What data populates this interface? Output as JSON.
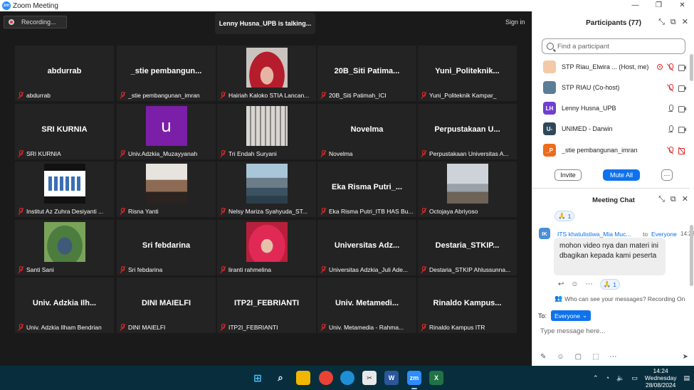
{
  "window": {
    "title": "Zoom Meeting",
    "controls": [
      "—",
      "❐",
      "✕"
    ]
  },
  "meeting": {
    "recording_label": "Recording...",
    "talking_label": "Lenny Husna_UPB is talking...",
    "signin_label": "Sign in",
    "tiles": [
      {
        "center": "abdurrab",
        "name": "abdurrab",
        "thumb": ""
      },
      {
        "center": "_stie pembangun...",
        "name": "_stie pembangunan_imran",
        "thumb": ""
      },
      {
        "center": "",
        "name": "Hairiah Kaloko STIA Lancan...",
        "thumb": "hijab-red"
      },
      {
        "center": "20B_Siti Patima...",
        "name": "20B_Siti Patimah_ICI",
        "thumb": ""
      },
      {
        "center": "Yuni_Politeknik...",
        "name": "Yuni_Politeknik Kampar_",
        "thumb": ""
      },
      {
        "center": "SRI KURNIA",
        "name": "SRI KURNIA",
        "thumb": ""
      },
      {
        "center": "",
        "name": "Univ.Adzkia_Muzayyanah",
        "thumb": "letter-u",
        "letter": "u"
      },
      {
        "center": "",
        "name": "Tri Endah Suryani",
        "thumb": "forest"
      },
      {
        "center": "Novelma",
        "name": "Novelma",
        "thumb": ""
      },
      {
        "center": "Perpustakaan U...",
        "name": "Perpustakaan Universitas A...",
        "thumb": ""
      },
      {
        "center": "",
        "name": "Institut Az Zuhra Desiyanti ...",
        "thumb": "screen"
      },
      {
        "center": "",
        "name": "Risna Yanti",
        "thumb": "woman-couch"
      },
      {
        "center": "",
        "name": "Nelsy Mariza Syahyuda_ST...",
        "thumb": "mountain"
      },
      {
        "center": "Eka Risma Putri_...",
        "name": "Eka Risma Putri_ITB HAS Bu...",
        "thumb": ""
      },
      {
        "center": "",
        "name": "Octojaya Abriyoso",
        "thumb": "building"
      },
      {
        "center": "",
        "name": "Santi Sani",
        "thumb": "garden"
      },
      {
        "center": "Sri febdarina",
        "name": "Sri febdarina",
        "thumb": ""
      },
      {
        "center": "",
        "name": "liranti rahmelina",
        "thumb": "pink"
      },
      {
        "center": "Universitas Adz...",
        "name": "Universitas Adzkia_Juli Ade...",
        "thumb": ""
      },
      {
        "center": "Destaria_STKIP...",
        "name": "Destaria_STKIP Ahlussunna...",
        "thumb": ""
      },
      {
        "center": "Univ. Adzkia Ilh...",
        "name": "Univ. Adzkia Ilham Bendrian",
        "thumb": ""
      },
      {
        "center": "DINI MAIELFI",
        "name": "DINI MAIELFI",
        "thumb": ""
      },
      {
        "center": "ITP2I_FEBRIANTI",
        "name": "ITP2I_FEBRIANTI",
        "thumb": ""
      },
      {
        "center": "Univ. Metamedi...",
        "name": "Univ. Metamedia - Rahma...",
        "thumb": ""
      },
      {
        "center": "Rinaldo Kampus...",
        "name": "Rinaldo Kampus ITR",
        "thumb": ""
      }
    ]
  },
  "participants": {
    "title": "Participants (77)",
    "search_placeholder": "Find a participant",
    "list": [
      {
        "name": "STP Riau_Elwira ... (Host, me)",
        "avatar_text": "",
        "avatar_color": "#f3c9a8",
        "icons": [
          "rec",
          "mic-off",
          "cam"
        ]
      },
      {
        "name": "STP RIAU (Co-host)",
        "avatar_text": "",
        "avatar_color": "#5b7d95",
        "icons": [
          "mic-off",
          "cam"
        ]
      },
      {
        "name": "Lenny Husna_UPB",
        "avatar_text": "LH",
        "avatar_color": "#6f3fcf",
        "icons": [
          "mic",
          "cam"
        ]
      },
      {
        "name": "UNIMED - Darwin",
        "avatar_text": "U-",
        "avatar_color": "#2f4858",
        "icons": [
          "mic",
          "cam"
        ]
      },
      {
        "name": "_stie pembangunan_imran",
        "avatar_text": "_P",
        "avatar_color": "#ef6c1a",
        "icons": [
          "mic-off",
          "cam-off"
        ]
      }
    ],
    "invite_label": "Invite",
    "mute_all_label": "Mute All",
    "more_label": "···"
  },
  "chat": {
    "title": "Meeting Chat",
    "reaction_top": {
      "emoji": "🙏",
      "count": "1"
    },
    "sender_avatar": "IK",
    "sender": "ITS khatulistiwa_Mia Muc...",
    "to_word": "to",
    "to_target": "Everyone",
    "time": "14:23",
    "message": "mohon video nya dan materi ini dbagikan kepada kami peserta",
    "reaction_bottom": {
      "emoji": "🙏",
      "count": "1"
    },
    "privacy": "Who can see your messages? Recording On",
    "to_label": "To:",
    "recipient": "Everyone",
    "input_placeholder": "Type message here..."
  },
  "taskbar": {
    "time": "14:24",
    "day": "Wednesday",
    "date": "28/08/2024"
  }
}
